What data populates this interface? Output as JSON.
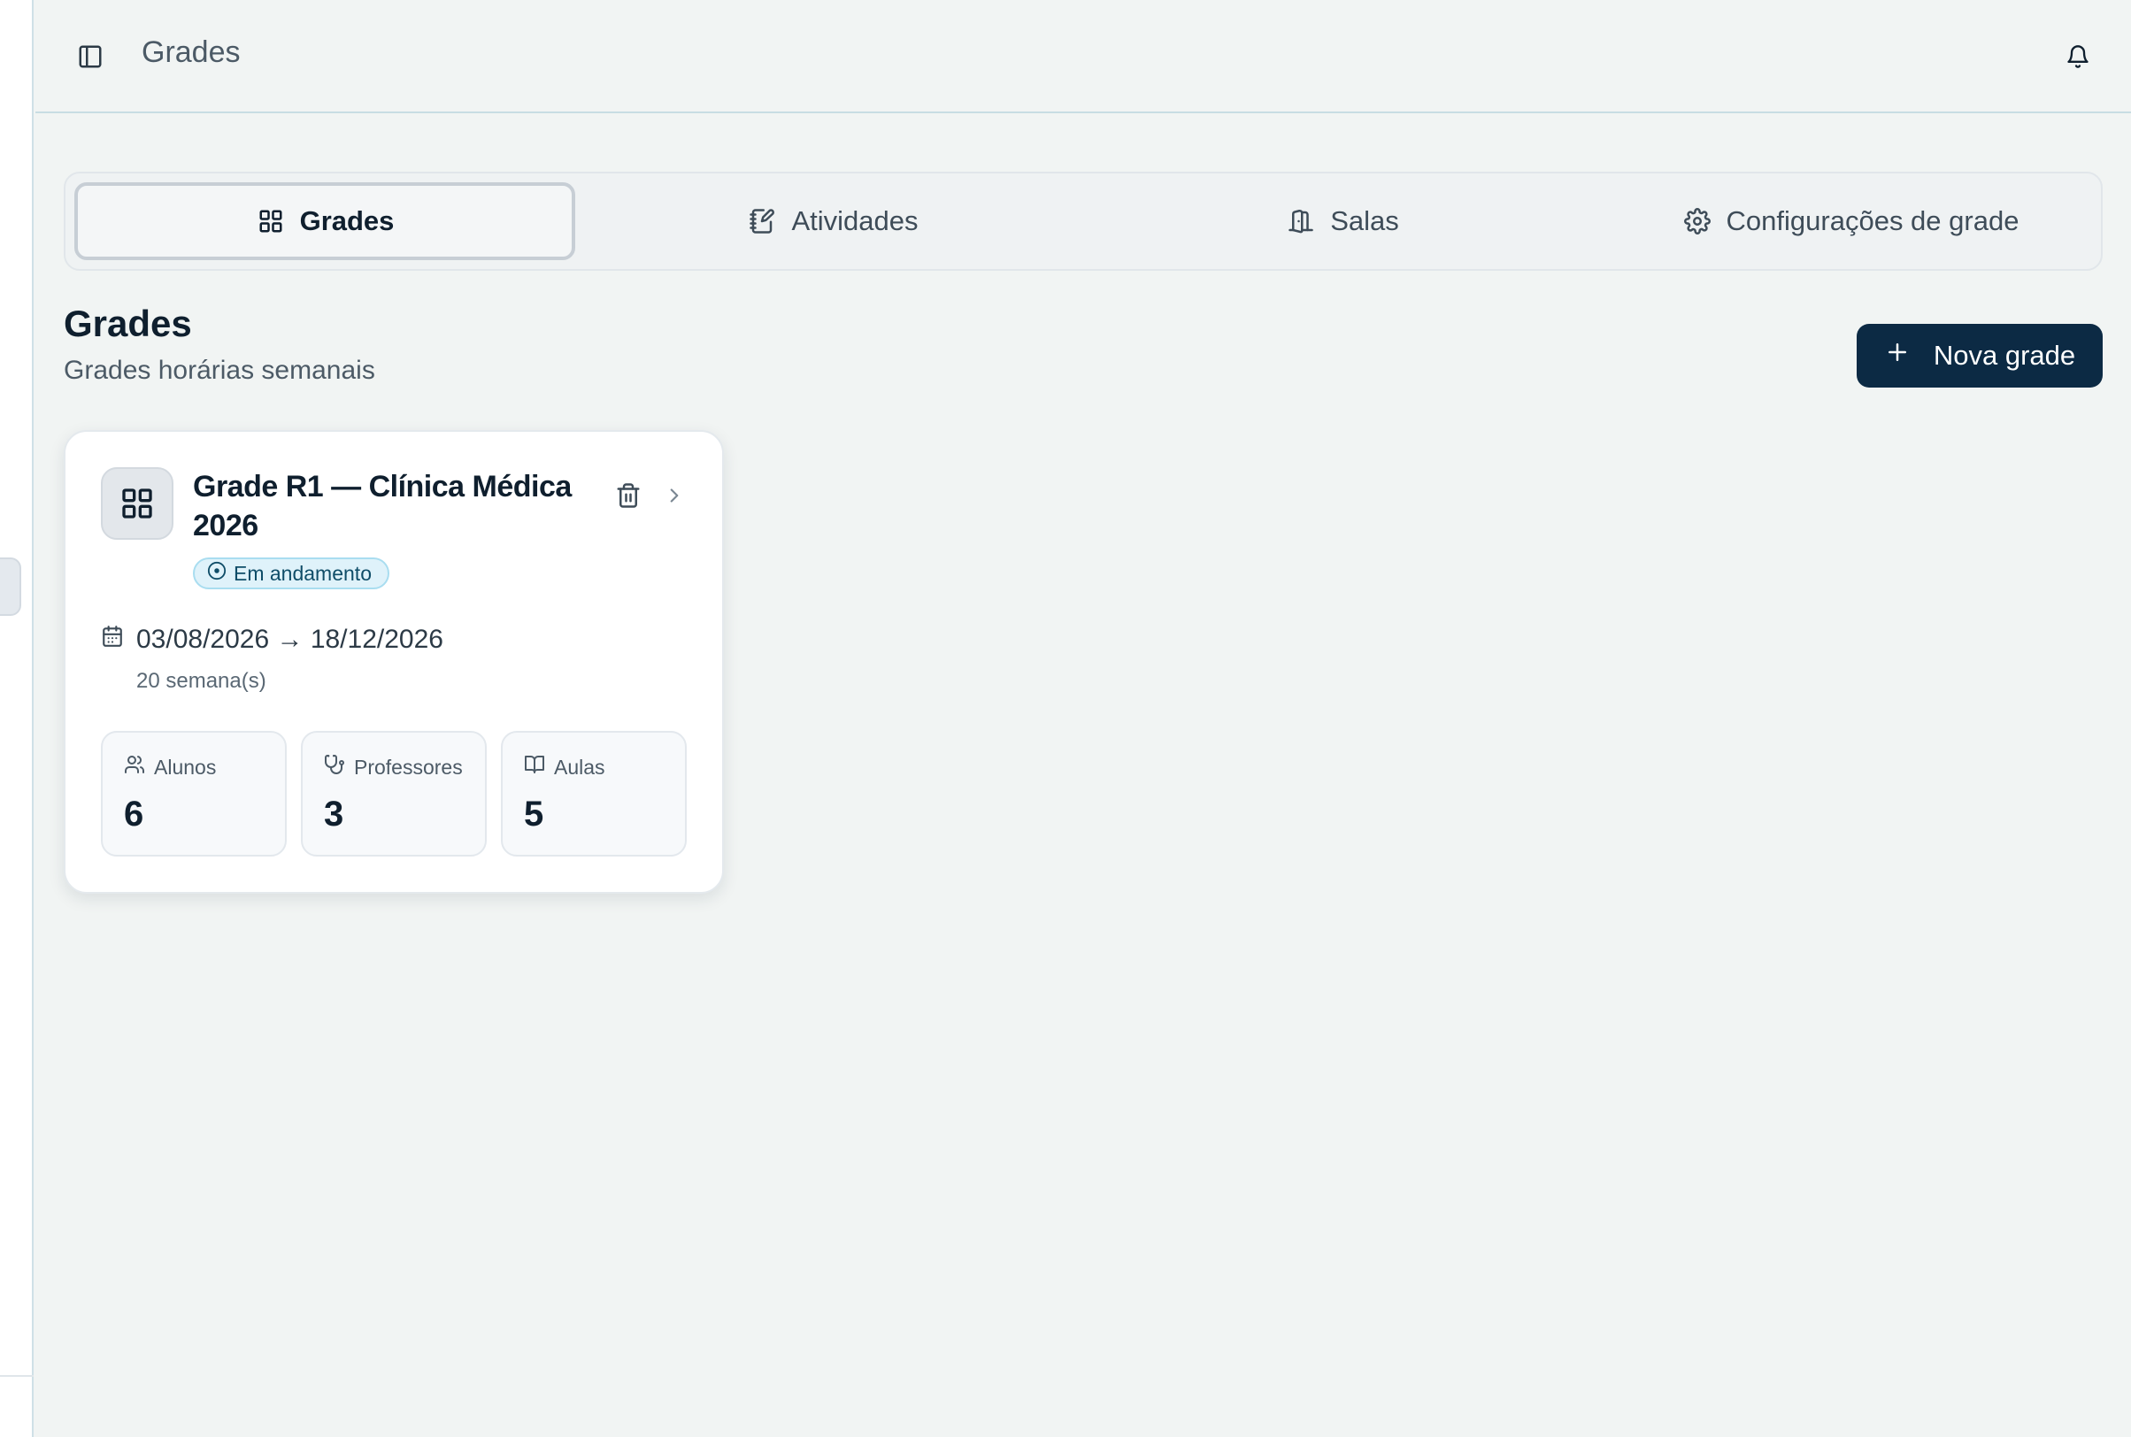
{
  "topbar": {
    "title": "Grades"
  },
  "tabs": [
    {
      "label": "Grades",
      "icon": "grid-icon",
      "active": true
    },
    {
      "label": "Atividades",
      "icon": "edit-note-icon",
      "active": false
    },
    {
      "label": "Salas",
      "icon": "door-icon",
      "active": false
    },
    {
      "label": "Configurações de grade",
      "icon": "gear-icon",
      "active": false
    }
  ],
  "header": {
    "title": "Grades",
    "subtitle": "Grades horárias semanais",
    "new_button_label": "Nova grade"
  },
  "cards": [
    {
      "title": "Grade R1 — Clínica Médica 2026",
      "status": "Em andamento",
      "date_range": "03/08/2026 → 18/12/2026",
      "weeks": "20 semana(s)",
      "stats": [
        {
          "label": "Alunos",
          "value": "6",
          "icon": "users-icon"
        },
        {
          "label": "Professores",
          "value": "3",
          "icon": "stethoscope-icon"
        },
        {
          "label": "Aulas",
          "value": "5",
          "icon": "book-icon"
        }
      ]
    }
  ],
  "colors": {
    "primary": "#0c2a44",
    "background": "#f1f4f3",
    "badge_bg": "#dff2fa",
    "badge_text": "#0f4d68"
  }
}
